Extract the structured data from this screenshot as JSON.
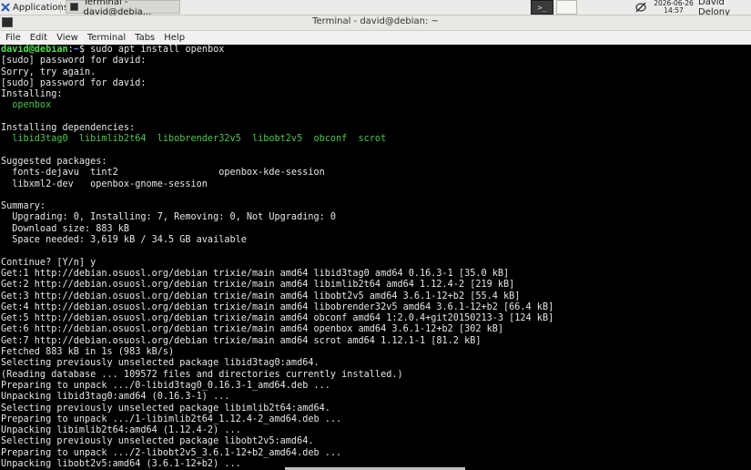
{
  "panel": {
    "applications_label": "Applications",
    "taskbar_item": "Terminal - david@debia...",
    "clock_date": "2026-06-26",
    "clock_time": "14:57",
    "user_name": "David Delony",
    "terminal_glyph": ">_"
  },
  "window": {
    "title": "Terminal - david@debian: ~"
  },
  "menu": {
    "items": [
      "File",
      "Edit",
      "View",
      "Terminal",
      "Tabs",
      "Help"
    ]
  },
  "terminal": {
    "prompt_user": "david@debian",
    "prompt_path": "~",
    "prompt_suffix": "$ ",
    "command": "sudo apt install openbox",
    "lines": [
      "[sudo] password for david:",
      "Sorry, try again.",
      "[sudo] password for david:",
      "Installing:",
      "  openbox",
      "",
      "Installing dependencies:",
      "  libid3tag0  libimlib2t64  libobrender32v5  libobt2v5  obconf  scrot",
      "",
      "Suggested packages:",
      "  fonts-dejavu  tint2                  openbox-kde-session",
      "  libxml2-dev   openbox-gnome-session",
      "",
      "Summary:",
      "  Upgrading: 0, Installing: 7, Removing: 0, Not Upgrading: 0",
      "  Download size: 883 kB",
      "  Space needed: 3,619 kB / 34.5 GB available",
      "",
      "Continue? [Y/n] y",
      "Get:1 http://debian.osuosl.org/debian trixie/main amd64 libid3tag0 amd64 0.16.3-1 [35.0 kB]",
      "Get:2 http://debian.osuosl.org/debian trixie/main amd64 libimlib2t64 amd64 1.12.4-2 [219 kB]",
      "Get:3 http://debian.osuosl.org/debian trixie/main amd64 libobt2v5 amd64 3.6.1-12+b2 [55.4 kB]",
      "Get:4 http://debian.osuosl.org/debian trixie/main amd64 libobrender32v5 amd64 3.6.1-12+b2 [66.4 kB]",
      "Get:5 http://debian.osuosl.org/debian trixie/main amd64 obconf amd64 1:2.0.4+git20150213-3 [124 kB]",
      "Get:6 http://debian.osuosl.org/debian trixie/main amd64 openbox amd64 3.6.1-12+b2 [302 kB]",
      "Get:7 http://debian.osuosl.org/debian trixie/main amd64 scrot amd64 1.12.1-1 [81.2 kB]",
      "Fetched 883 kB in 1s (983 kB/s)",
      "Selecting previously unselected package libid3tag0:amd64.",
      "(Reading database ... 109572 files and directories currently installed.)",
      "Preparing to unpack .../0-libid3tag0_0.16.3-1_amd64.deb ...",
      "Unpacking libid3tag0:amd64 (0.16.3-1) ...",
      "Selecting previously unselected package libimlib2t64:amd64.",
      "Preparing to unpack .../1-libimlib2t64_1.12.4-2_amd64.deb ...",
      "Unpacking libimlib2t64:amd64 (1.12.4-2) ...",
      "Selecting previously unselected package libobt2v5:amd64.",
      "Preparing to unpack .../2-libobt2v5_3.6.1-12+b2_amd64.deb ...",
      "Unpacking libobt2v5:amd64 (3.6.1-12+b2) ..."
    ]
  }
}
